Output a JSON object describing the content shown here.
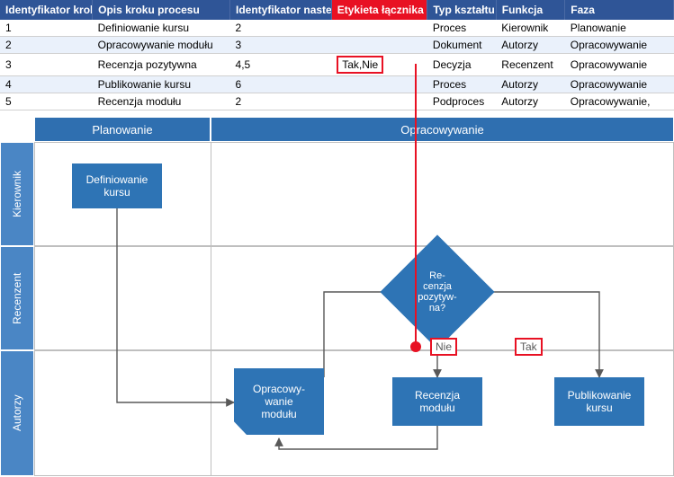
{
  "headers": {
    "id": "Identyfikator kroku p",
    "opis": "Opis kroku procesu",
    "nast": "Identyfikator naste",
    "et": "Etykieta łącznika",
    "typ": "Typ kształtu",
    "fun": "Funkcja",
    "faza": "Faza"
  },
  "rows": [
    {
      "id": "1",
      "opis": "Definiowanie kursu",
      "nast": "2",
      "et": "",
      "typ": "Proces",
      "fun": "Kierownik",
      "faza": "Planowanie"
    },
    {
      "id": "2",
      "opis": "Opracowywanie modułu",
      "nast": "3",
      "et": "",
      "typ": "Dokument",
      "fun": "Autorzy",
      "faza": "Opracowywanie"
    },
    {
      "id": "3",
      "opis": "Recenzja pozytywna",
      "nast": "4,5",
      "et": "Tak,Nie",
      "typ": "Decyzja",
      "fun": "Recenzent",
      "faza": "Opracowywanie"
    },
    {
      "id": "4",
      "opis": "Publikowanie kursu",
      "nast": "6",
      "et": "",
      "typ": "Proces",
      "fun": "Autorzy",
      "faza": "Opracowywanie"
    },
    {
      "id": "5",
      "opis": "Recenzja modułu",
      "nast": "2",
      "et": "",
      "typ": "Podproces",
      "fun": "Autorzy",
      "faza": "Opracowywanie,"
    }
  ],
  "phases": {
    "plan": "Planowanie",
    "opra": "Opracowywanie"
  },
  "lanes": {
    "l1": "Kierownik",
    "l2": "Recenzent",
    "l3": "Autorzy"
  },
  "shapes": {
    "def": "Definiowanie kursu",
    "opra": "Opracowy-\nwanie\nmodułu",
    "diamond": "Re-\ncenzja\npozytyw-\nna?",
    "rec": "Recenzja\nmodułu",
    "pub": "Publikowanie\nkursu"
  },
  "labels": {
    "nie": "Nie",
    "tak": "Tak"
  }
}
